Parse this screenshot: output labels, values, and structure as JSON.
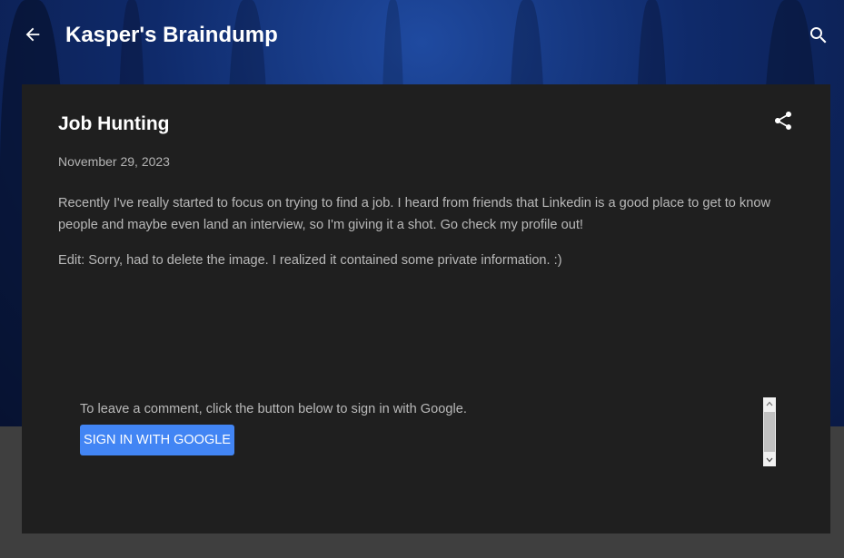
{
  "header": {
    "blog_title": "Kasper's Braindump",
    "back_icon": "arrow-back-icon",
    "search_icon": "search-icon"
  },
  "post": {
    "title": "Job Hunting",
    "date": "November 29, 2023",
    "share_icon": "share-icon",
    "paragraphs": [
      "Recently I've really started to focus on trying to find a job. I heard from friends that Linkedin is a good place to get to know people and maybe even land an interview, so I'm giving it a shot. Go check my profile out!",
      "Edit: Sorry, had to delete the image. I realized it contained some private information. :)"
    ]
  },
  "comments": {
    "prompt": "To leave a comment, click the button below to sign in with Google.",
    "signin_label": "SIGN IN WITH GOOGLE"
  },
  "colors": {
    "card_background": "#1f1f1f",
    "page_background": "#3f3f3f",
    "header_background": "#0f2a6a",
    "button_blue": "#4285f4",
    "title_text": "#ffffff",
    "body_text": "#b9b9b9"
  }
}
